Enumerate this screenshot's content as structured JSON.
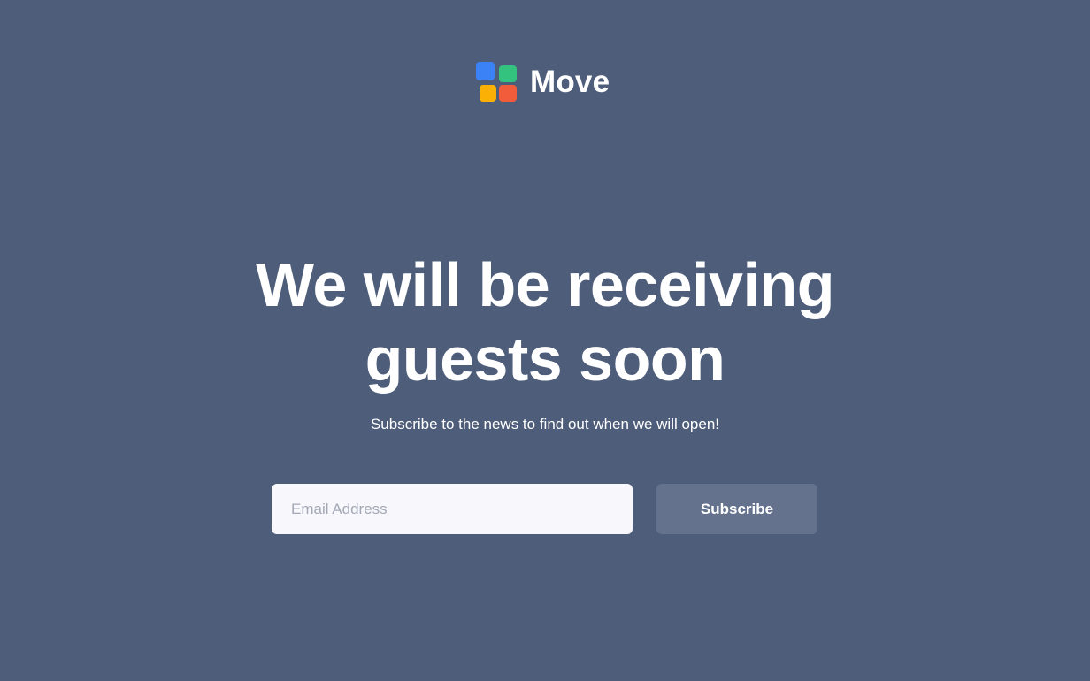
{
  "brand": {
    "name": "Move",
    "logo_colors": {
      "top_left": "#3b82f6",
      "top_right": "#34c37f",
      "bottom_left": "#fbb006",
      "bottom_right": "#f25c3b"
    }
  },
  "hero": {
    "headline_line1": "We will be receiving",
    "headline_line2": "guests soon",
    "subtitle": "Subscribe to the news to find out when we will open!"
  },
  "form": {
    "email_placeholder": "Email Address",
    "email_value": "",
    "subscribe_label": "Subscribe"
  },
  "theme": {
    "background": "#4e5d7a",
    "button_background": "#64728d",
    "input_background": "#f8f8fc"
  }
}
